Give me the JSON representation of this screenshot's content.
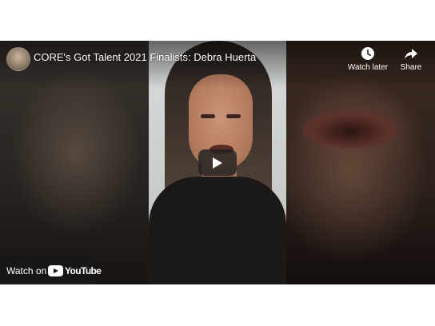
{
  "video": {
    "title": "CORE's Got Talent 2021 Finalists: Debra Huerta",
    "channel_avatar_icon": "channel-avatar"
  },
  "actions": {
    "watch_later_label": "Watch later",
    "watch_later_icon": "clock-icon",
    "share_label": "Share",
    "share_icon": "share-arrow-icon"
  },
  "player": {
    "play_icon": "play-icon"
  },
  "watch_on": {
    "label": "Watch on",
    "brand": "YouTube",
    "brand_icon": "youtube-logo-icon"
  },
  "colors": {
    "overlay_text": "#ffffff",
    "play_button_bg": "#212121"
  }
}
